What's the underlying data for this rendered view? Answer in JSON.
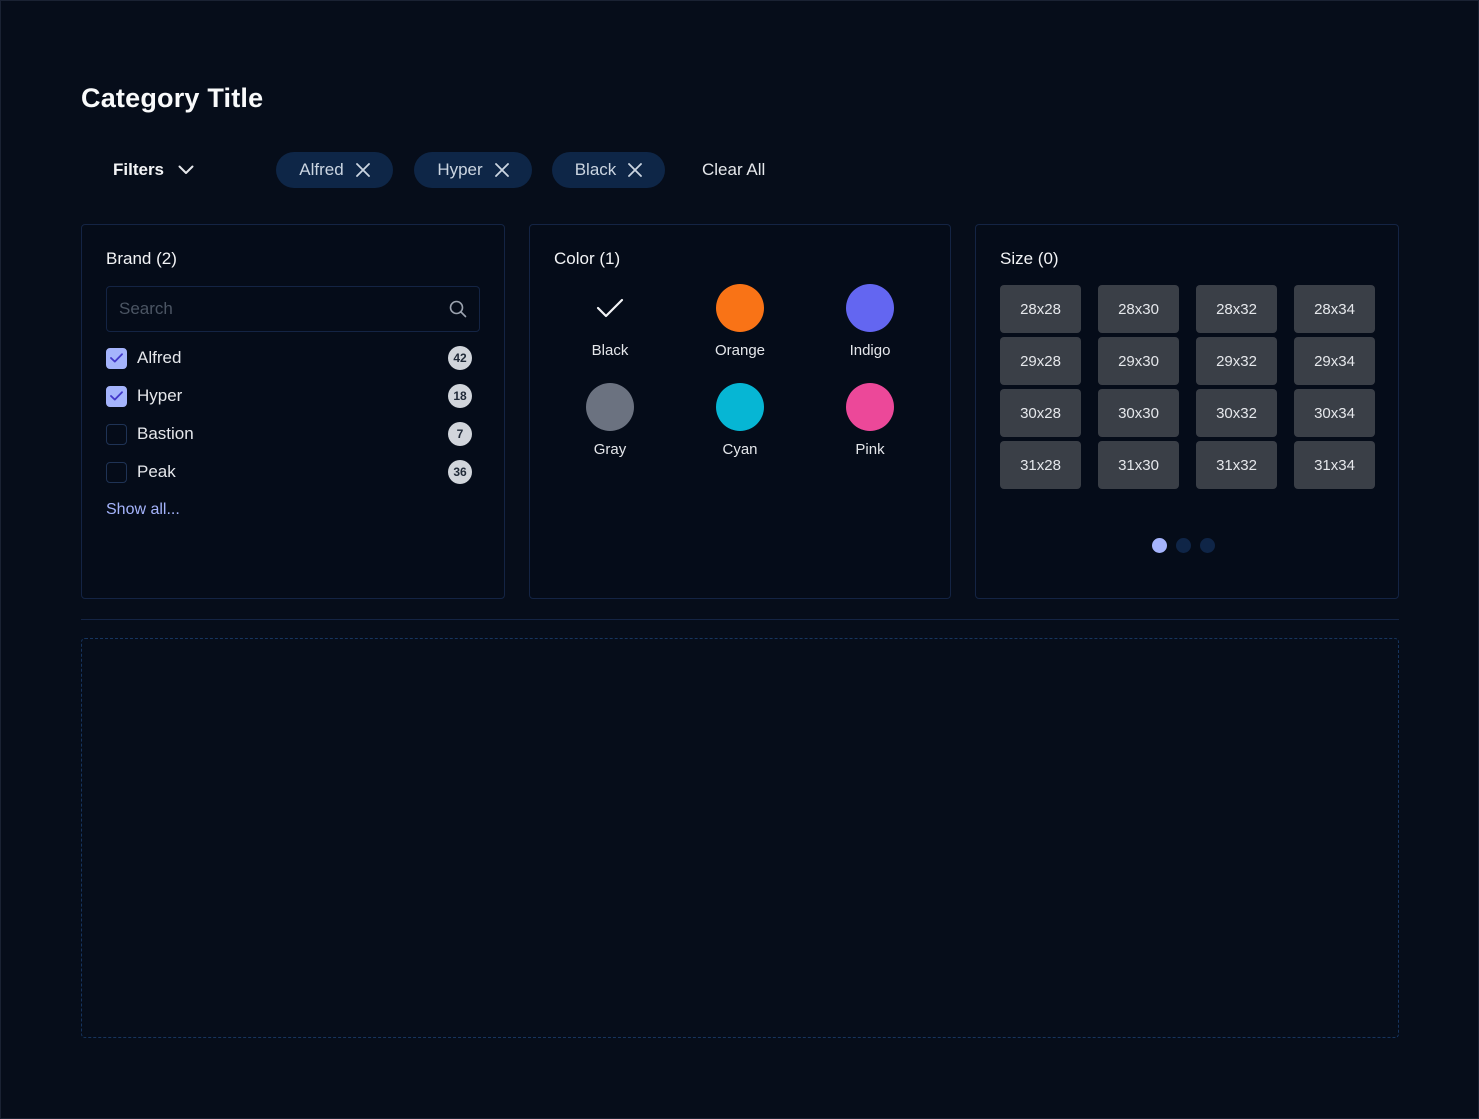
{
  "page": {
    "title": "Category Title"
  },
  "filter_bar": {
    "filters_label": "Filters",
    "active_filters": [
      "Alfred",
      "Hyper",
      "Black"
    ],
    "clear_all_label": "Clear All"
  },
  "brand_panel": {
    "title": "Brand (2)",
    "search_placeholder": "Search",
    "items": [
      {
        "label": "Alfred",
        "count": "42",
        "checked": true
      },
      {
        "label": "Hyper",
        "count": "18",
        "checked": true
      },
      {
        "label": "Bastion",
        "count": "7",
        "checked": false
      },
      {
        "label": "Peak",
        "count": "36",
        "checked": false
      }
    ],
    "show_all_label": "Show all..."
  },
  "color_panel": {
    "title": "Color (1)",
    "swatches": [
      {
        "label": "Black",
        "color": "#050c19",
        "selected": true
      },
      {
        "label": "Orange",
        "color": "#f97316",
        "selected": false
      },
      {
        "label": "Indigo",
        "color": "#6366f1",
        "selected": false
      },
      {
        "label": "Gray",
        "color": "#6b7280",
        "selected": false
      },
      {
        "label": "Cyan",
        "color": "#06b6d4",
        "selected": false
      },
      {
        "label": "Pink",
        "color": "#ec4899",
        "selected": false
      }
    ]
  },
  "size_panel": {
    "title": "Size (0)",
    "sizes": [
      [
        "28x28",
        "28x30",
        "28x32",
        "28x34"
      ],
      [
        "29x28",
        "29x30",
        "29x32",
        "29x34"
      ],
      [
        "30x28",
        "30x30",
        "30x32",
        "30x34"
      ],
      [
        "31x28",
        "31x30",
        "31x32",
        "31x34"
      ]
    ],
    "pager": {
      "pages": 3,
      "current": 1
    }
  },
  "colors": {
    "background": "#060d1a",
    "chip_bg": "#0e2647",
    "accent": "#a5b4fc",
    "panel_border": "#142444",
    "size_button_bg": "#3a3f47"
  }
}
